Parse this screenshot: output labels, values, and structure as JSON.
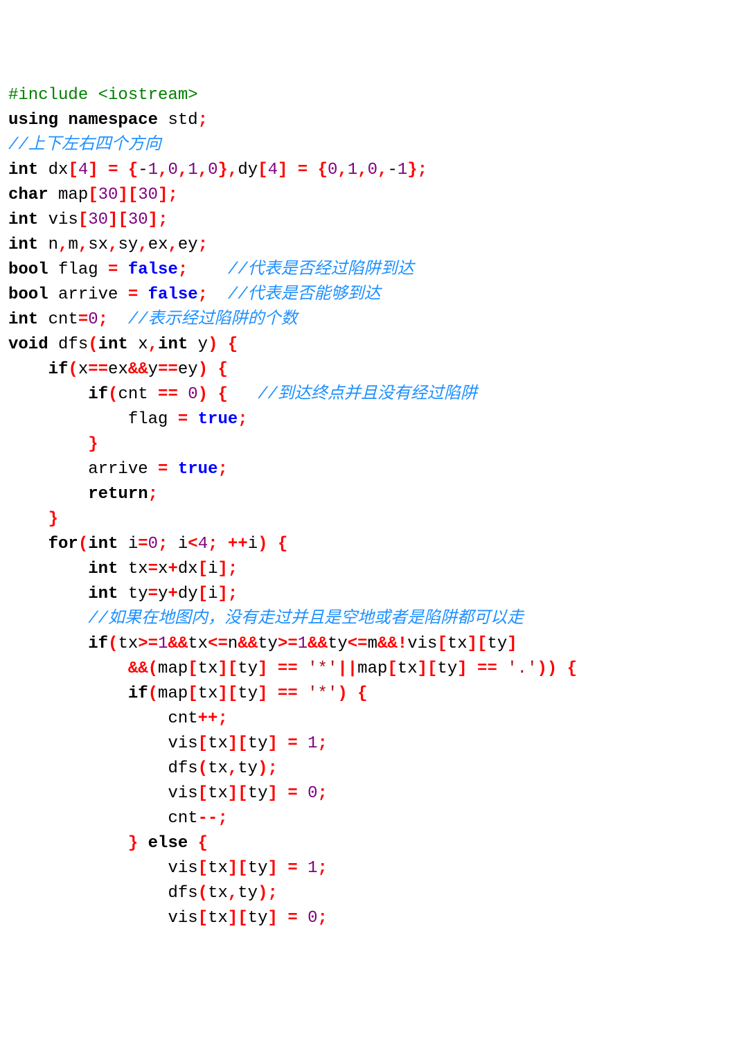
{
  "lines": [
    [
      [
        "preproc",
        "#include <iostream>"
      ]
    ],
    [
      [
        "kw",
        "using namespace"
      ],
      [
        "id",
        " std"
      ],
      [
        "punc",
        ";"
      ]
    ],
    [
      [
        "comment",
        "//上下左右四个方向"
      ]
    ],
    [
      [
        "type",
        "int"
      ],
      [
        "id",
        " dx"
      ],
      [
        "bkt",
        "["
      ],
      [
        "num",
        "4"
      ],
      [
        "bkt",
        "]"
      ],
      [
        "id",
        " "
      ],
      [
        "punc",
        "="
      ],
      [
        "id",
        " "
      ],
      [
        "punc",
        "{"
      ],
      [
        "op",
        "-"
      ],
      [
        "num",
        "1"
      ],
      [
        "punc",
        ","
      ],
      [
        "num",
        "0"
      ],
      [
        "punc",
        ","
      ],
      [
        "num",
        "1"
      ],
      [
        "punc",
        ","
      ],
      [
        "num",
        "0"
      ],
      [
        "punc",
        "},"
      ],
      [
        "id",
        "dy"
      ],
      [
        "bkt",
        "["
      ],
      [
        "num",
        "4"
      ],
      [
        "bkt",
        "]"
      ],
      [
        "id",
        " "
      ],
      [
        "punc",
        "="
      ],
      [
        "id",
        " "
      ],
      [
        "punc",
        "{"
      ],
      [
        "num",
        "0"
      ],
      [
        "punc",
        ","
      ],
      [
        "num",
        "1"
      ],
      [
        "punc",
        ","
      ],
      [
        "num",
        "0"
      ],
      [
        "punc",
        ","
      ],
      [
        "op",
        "-"
      ],
      [
        "num",
        "1"
      ],
      [
        "punc",
        "};"
      ]
    ],
    [
      [
        "type",
        "char"
      ],
      [
        "id",
        " map"
      ],
      [
        "bkt",
        "["
      ],
      [
        "num",
        "30"
      ],
      [
        "bkt",
        "]["
      ],
      [
        "num",
        "30"
      ],
      [
        "bkt",
        "]"
      ],
      [
        "punc",
        ";"
      ]
    ],
    [
      [
        "type",
        "int"
      ],
      [
        "id",
        " vis"
      ],
      [
        "bkt",
        "["
      ],
      [
        "num",
        "30"
      ],
      [
        "bkt",
        "]["
      ],
      [
        "num",
        "30"
      ],
      [
        "bkt",
        "]"
      ],
      [
        "punc",
        ";"
      ]
    ],
    [
      [
        "type",
        "int"
      ],
      [
        "id",
        " n"
      ],
      [
        "punc",
        ","
      ],
      [
        "id",
        "m"
      ],
      [
        "punc",
        ","
      ],
      [
        "id",
        "sx"
      ],
      [
        "punc",
        ","
      ],
      [
        "id",
        "sy"
      ],
      [
        "punc",
        ","
      ],
      [
        "id",
        "ex"
      ],
      [
        "punc",
        ","
      ],
      [
        "id",
        "ey"
      ],
      [
        "punc",
        ";"
      ]
    ],
    [
      [
        "type",
        "bool"
      ],
      [
        "id",
        " flag "
      ],
      [
        "punc",
        "="
      ],
      [
        "id",
        " "
      ],
      [
        "kwb",
        "false"
      ],
      [
        "punc",
        ";"
      ],
      [
        "id",
        "    "
      ],
      [
        "comment",
        "//代表是否经过陷阱到达"
      ]
    ],
    [
      [
        "type",
        "bool"
      ],
      [
        "id",
        " arrive "
      ],
      [
        "punc",
        "="
      ],
      [
        "id",
        " "
      ],
      [
        "kwb",
        "false"
      ],
      [
        "punc",
        ";"
      ],
      [
        "id",
        "  "
      ],
      [
        "comment",
        "//代表是否能够到达"
      ]
    ],
    [
      [
        "type",
        "int"
      ],
      [
        "id",
        " cnt"
      ],
      [
        "punc",
        "="
      ],
      [
        "num",
        "0"
      ],
      [
        "punc",
        ";"
      ],
      [
        "id",
        "  "
      ],
      [
        "comment",
        "//表示经过陷阱的个数"
      ]
    ],
    [
      [
        "type",
        "void"
      ],
      [
        "id",
        " dfs"
      ],
      [
        "punc",
        "("
      ],
      [
        "type",
        "int"
      ],
      [
        "id",
        " x"
      ],
      [
        "punc",
        ","
      ],
      [
        "type",
        "int"
      ],
      [
        "id",
        " y"
      ],
      [
        "punc",
        ")"
      ],
      [
        "id",
        " "
      ],
      [
        "punc",
        "{"
      ]
    ],
    [
      [
        "id",
        "    "
      ],
      [
        "kw",
        "if"
      ],
      [
        "punc",
        "("
      ],
      [
        "id",
        "x"
      ],
      [
        "punc",
        "=="
      ],
      [
        "id",
        "ex"
      ],
      [
        "punc",
        "&&"
      ],
      [
        "id",
        "y"
      ],
      [
        "punc",
        "=="
      ],
      [
        "id",
        "ey"
      ],
      [
        "punc",
        ")"
      ],
      [
        "id",
        " "
      ],
      [
        "punc",
        "{"
      ]
    ],
    [
      [
        "id",
        "        "
      ],
      [
        "kw",
        "if"
      ],
      [
        "punc",
        "("
      ],
      [
        "id",
        "cnt "
      ],
      [
        "punc",
        "=="
      ],
      [
        "id",
        " "
      ],
      [
        "num",
        "0"
      ],
      [
        "punc",
        ")"
      ],
      [
        "id",
        " "
      ],
      [
        "punc",
        "{"
      ],
      [
        "id",
        "   "
      ],
      [
        "comment",
        "//到达终点并且没有经过陷阱"
      ]
    ],
    [
      [
        "id",
        "            flag "
      ],
      [
        "punc",
        "="
      ],
      [
        "id",
        " "
      ],
      [
        "kwb",
        "true"
      ],
      [
        "punc",
        ";"
      ]
    ],
    [
      [
        "id",
        "        "
      ],
      [
        "punc",
        "}"
      ]
    ],
    [
      [
        "id",
        "        arrive "
      ],
      [
        "punc",
        "="
      ],
      [
        "id",
        " "
      ],
      [
        "kwb",
        "true"
      ],
      [
        "punc",
        ";"
      ]
    ],
    [
      [
        "id",
        "        "
      ],
      [
        "kw",
        "return"
      ],
      [
        "punc",
        ";"
      ]
    ],
    [
      [
        "id",
        "    "
      ],
      [
        "punc",
        "}"
      ]
    ],
    [
      [
        "id",
        "    "
      ],
      [
        "kw",
        "for"
      ],
      [
        "punc",
        "("
      ],
      [
        "type",
        "int"
      ],
      [
        "id",
        " i"
      ],
      [
        "punc",
        "="
      ],
      [
        "num",
        "0"
      ],
      [
        "punc",
        ";"
      ],
      [
        "id",
        " i"
      ],
      [
        "punc",
        "<"
      ],
      [
        "num",
        "4"
      ],
      [
        "punc",
        ";"
      ],
      [
        "id",
        " "
      ],
      [
        "punc",
        "++"
      ],
      [
        "id",
        "i"
      ],
      [
        "punc",
        ")"
      ],
      [
        "id",
        " "
      ],
      [
        "punc",
        "{"
      ]
    ],
    [
      [
        "id",
        "        "
      ],
      [
        "type",
        "int"
      ],
      [
        "id",
        " tx"
      ],
      [
        "punc",
        "="
      ],
      [
        "id",
        "x"
      ],
      [
        "punc",
        "+"
      ],
      [
        "id",
        "dx"
      ],
      [
        "bkt",
        "["
      ],
      [
        "id",
        "i"
      ],
      [
        "bkt",
        "]"
      ],
      [
        "punc",
        ";"
      ]
    ],
    [
      [
        "id",
        "        "
      ],
      [
        "type",
        "int"
      ],
      [
        "id",
        " ty"
      ],
      [
        "punc",
        "="
      ],
      [
        "id",
        "y"
      ],
      [
        "punc",
        "+"
      ],
      [
        "id",
        "dy"
      ],
      [
        "bkt",
        "["
      ],
      [
        "id",
        "i"
      ],
      [
        "bkt",
        "]"
      ],
      [
        "punc",
        ";"
      ]
    ],
    [
      [
        "id",
        "        "
      ],
      [
        "comment",
        "//如果在地图内，没有走过并且是空地或者是陷阱都可以走"
      ]
    ],
    [
      [
        "id",
        "        "
      ],
      [
        "kw",
        "if"
      ],
      [
        "punc",
        "("
      ],
      [
        "id",
        "tx"
      ],
      [
        "punc",
        ">="
      ],
      [
        "num",
        "1"
      ],
      [
        "punc",
        "&&"
      ],
      [
        "id",
        "tx"
      ],
      [
        "punc",
        "<="
      ],
      [
        "id",
        "n"
      ],
      [
        "punc",
        "&&"
      ],
      [
        "id",
        "ty"
      ],
      [
        "punc",
        ">="
      ],
      [
        "num",
        "1"
      ],
      [
        "punc",
        "&&"
      ],
      [
        "id",
        "ty"
      ],
      [
        "punc",
        "<="
      ],
      [
        "id",
        "m"
      ],
      [
        "punc",
        "&&!"
      ],
      [
        "id",
        "vis"
      ],
      [
        "bkt",
        "["
      ],
      [
        "id",
        "tx"
      ],
      [
        "bkt",
        "]["
      ],
      [
        "id",
        "ty"
      ],
      [
        "bkt",
        "]"
      ]
    ],
    [
      [
        "id",
        "            "
      ],
      [
        "punc",
        "&&("
      ],
      [
        "id",
        "map"
      ],
      [
        "bkt",
        "["
      ],
      [
        "id",
        "tx"
      ],
      [
        "bkt",
        "]["
      ],
      [
        "id",
        "ty"
      ],
      [
        "bkt",
        "]"
      ],
      [
        "id",
        " "
      ],
      [
        "punc",
        "=="
      ],
      [
        "id",
        " "
      ],
      [
        "str",
        "'*'"
      ],
      [
        "punc",
        "||"
      ],
      [
        "id",
        "map"
      ],
      [
        "bkt",
        "["
      ],
      [
        "id",
        "tx"
      ],
      [
        "bkt",
        "]["
      ],
      [
        "id",
        "ty"
      ],
      [
        "bkt",
        "]"
      ],
      [
        "id",
        " "
      ],
      [
        "punc",
        "=="
      ],
      [
        "id",
        " "
      ],
      [
        "str",
        "'.'"
      ],
      [
        "punc",
        "))"
      ],
      [
        "id",
        " "
      ],
      [
        "punc",
        "{"
      ]
    ],
    [
      [
        "id",
        "            "
      ],
      [
        "kw",
        "if"
      ],
      [
        "punc",
        "("
      ],
      [
        "id",
        "map"
      ],
      [
        "bkt",
        "["
      ],
      [
        "id",
        "tx"
      ],
      [
        "bkt",
        "]["
      ],
      [
        "id",
        "ty"
      ],
      [
        "bkt",
        "]"
      ],
      [
        "id",
        " "
      ],
      [
        "punc",
        "=="
      ],
      [
        "id",
        " "
      ],
      [
        "str",
        "'*'"
      ],
      [
        "punc",
        ")"
      ],
      [
        "id",
        " "
      ],
      [
        "punc",
        "{"
      ]
    ],
    [
      [
        "id",
        "                cnt"
      ],
      [
        "punc",
        "++;"
      ]
    ],
    [
      [
        "id",
        "                vis"
      ],
      [
        "bkt",
        "["
      ],
      [
        "id",
        "tx"
      ],
      [
        "bkt",
        "]["
      ],
      [
        "id",
        "ty"
      ],
      [
        "bkt",
        "]"
      ],
      [
        "id",
        " "
      ],
      [
        "punc",
        "="
      ],
      [
        "id",
        " "
      ],
      [
        "num",
        "1"
      ],
      [
        "punc",
        ";"
      ]
    ],
    [
      [
        "id",
        "                dfs"
      ],
      [
        "punc",
        "("
      ],
      [
        "id",
        "tx"
      ],
      [
        "punc",
        ","
      ],
      [
        "id",
        "ty"
      ],
      [
        "punc",
        ");"
      ]
    ],
    [
      [
        "id",
        "                vis"
      ],
      [
        "bkt",
        "["
      ],
      [
        "id",
        "tx"
      ],
      [
        "bkt",
        "]["
      ],
      [
        "id",
        "ty"
      ],
      [
        "bkt",
        "]"
      ],
      [
        "id",
        " "
      ],
      [
        "punc",
        "="
      ],
      [
        "id",
        " "
      ],
      [
        "num",
        "0"
      ],
      [
        "punc",
        ";"
      ]
    ],
    [
      [
        "id",
        "                cnt"
      ],
      [
        "punc",
        "--;"
      ]
    ],
    [
      [
        "id",
        "            "
      ],
      [
        "punc",
        "}"
      ],
      [
        "id",
        " "
      ],
      [
        "kw",
        "else"
      ],
      [
        "id",
        " "
      ],
      [
        "punc",
        "{"
      ]
    ],
    [
      [
        "id",
        "                vis"
      ],
      [
        "bkt",
        "["
      ],
      [
        "id",
        "tx"
      ],
      [
        "bkt",
        "]["
      ],
      [
        "id",
        "ty"
      ],
      [
        "bkt",
        "]"
      ],
      [
        "id",
        " "
      ],
      [
        "punc",
        "="
      ],
      [
        "id",
        " "
      ],
      [
        "num",
        "1"
      ],
      [
        "punc",
        ";"
      ]
    ],
    [
      [
        "id",
        "                dfs"
      ],
      [
        "punc",
        "("
      ],
      [
        "id",
        "tx"
      ],
      [
        "punc",
        ","
      ],
      [
        "id",
        "ty"
      ],
      [
        "punc",
        ");"
      ]
    ],
    [
      [
        "id",
        "                vis"
      ],
      [
        "bkt",
        "["
      ],
      [
        "id",
        "tx"
      ],
      [
        "bkt",
        "]["
      ],
      [
        "id",
        "ty"
      ],
      [
        "bkt",
        "]"
      ],
      [
        "id",
        " "
      ],
      [
        "punc",
        "="
      ],
      [
        "id",
        " "
      ],
      [
        "num",
        "0"
      ],
      [
        "punc",
        ";"
      ]
    ]
  ]
}
